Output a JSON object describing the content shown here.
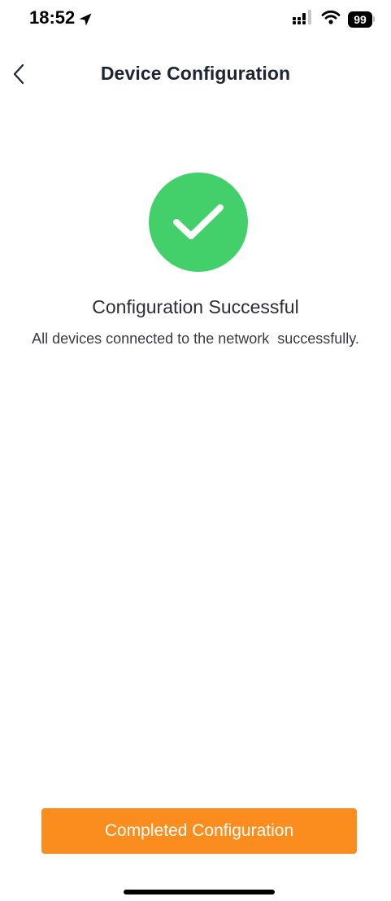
{
  "status_bar": {
    "time": "18:52",
    "battery_level": "99",
    "icons": [
      "location-arrow-icon",
      "signal-bars-icon",
      "wifi-icon",
      "battery-icon"
    ]
  },
  "header": {
    "title": "Device Configuration",
    "back_icon": "chevron-left-icon"
  },
  "result": {
    "icon": "check-circle-icon",
    "icon_color": "#43d06a",
    "title": "Configuration Successful",
    "message": "All devices connected to the network  successfully."
  },
  "actions": {
    "complete_label": "Completed Configuration",
    "complete_color": "#fb8c1e"
  }
}
